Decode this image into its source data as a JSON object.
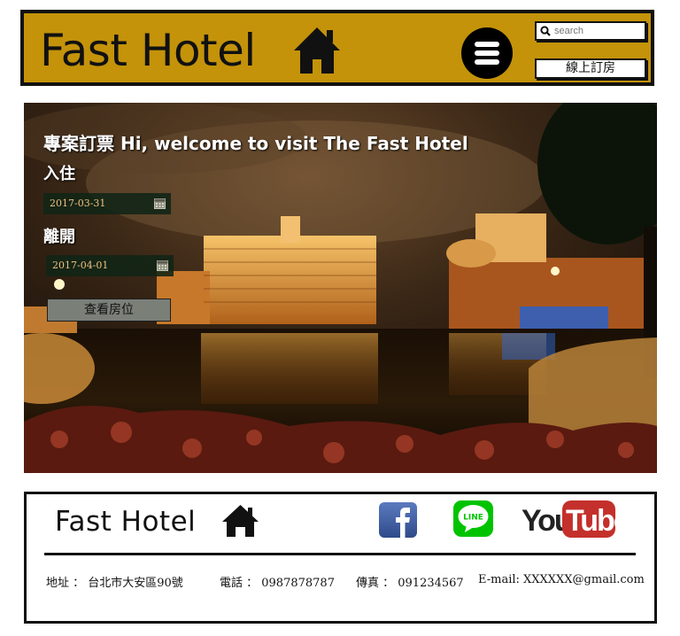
{
  "header": {
    "brand": "Fast Hotel",
    "search": {
      "placeholder": "search",
      "value": ""
    },
    "book_label": "線上訂房",
    "icons": [
      "home-icon",
      "menu-icon",
      "search-icon"
    ]
  },
  "hero": {
    "title": "專案訂票 Hi, welcome to visit The Fast Hotel",
    "checkin_label": "入住",
    "checkin_date": "2017-03-31",
    "checkout_label": "離開",
    "checkout_date": "2017-04-01",
    "search_button": "查看房位"
  },
  "footer": {
    "brand": "Fast Hotel",
    "social": [
      "facebook-icon",
      "line-icon",
      "youtube-icon"
    ],
    "line_text": "LINE",
    "youtube_you": "You",
    "youtube_tube": "Tube",
    "address": "地址 ： 台北市大安區90號",
    "phone": "電話 ： 0987878787",
    "fax": "傳真 ： 091234567",
    "email": "E-mail: XXXXXX@gmail.com"
  },
  "colors": {
    "header_bg": "#C4930A",
    "facebook": "#3B5998",
    "line": "#00C300",
    "youtube": "#C4302B"
  }
}
